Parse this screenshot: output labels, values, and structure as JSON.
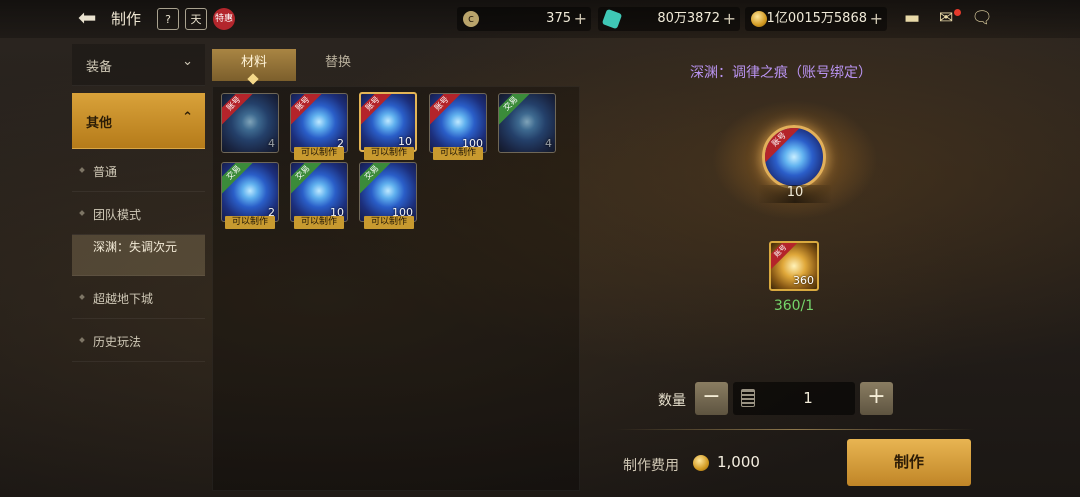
{
  "header": {
    "title": "制作",
    "help_icon": "?",
    "calendar_icon": "天",
    "shop_badge": "特惠",
    "currencies": [
      {
        "icon": "coin-c-icon",
        "value": "375",
        "color": "#c9b27a"
      },
      {
        "icon": "crystal-icon",
        "value": "80万3872",
        "color": "#3fc7b5"
      },
      {
        "icon": "gold-coin-icon",
        "value": "1亿0015万5868",
        "color": "#e5b23a"
      }
    ],
    "plus": "+"
  },
  "sidebar": {
    "sections": [
      {
        "label": "装备",
        "expanded": false
      },
      {
        "label": "其他",
        "expanded": true
      }
    ],
    "items": [
      "普通",
      "团队模式",
      "深渊：失调次元",
      "超越地下城",
      "历史玩法"
    ],
    "selected_index": 2
  },
  "tabs": [
    {
      "label": "材料",
      "active": true
    },
    {
      "label": "替换",
      "active": false
    }
  ],
  "grid": {
    "items": [
      {
        "tag": "账号",
        "tag_color": "red",
        "count": "4",
        "dim": true,
        "craftable": false,
        "selected": false
      },
      {
        "tag": "账号",
        "tag_color": "red",
        "count": "2",
        "dim": false,
        "craftable": true,
        "selected": false
      },
      {
        "tag": "账号",
        "tag_color": "red",
        "count": "10",
        "dim": false,
        "craftable": true,
        "selected": true
      },
      {
        "tag": "账号",
        "tag_color": "red",
        "count": "100",
        "dim": false,
        "craftable": true,
        "selected": false
      },
      {
        "tag": "交易",
        "tag_color": "green",
        "count": "4",
        "dim": true,
        "craftable": false,
        "selected": false
      },
      {
        "tag": "交易",
        "tag_color": "green",
        "count": "2",
        "dim": false,
        "craftable": true,
        "selected": false
      },
      {
        "tag": "交易",
        "tag_color": "green",
        "count": "10",
        "dim": false,
        "craftable": true,
        "selected": false
      },
      {
        "tag": "交易",
        "tag_color": "green",
        "count": "100",
        "dim": false,
        "craftable": true,
        "selected": false
      }
    ],
    "craftable_label": "可以制作"
  },
  "detail": {
    "title": "深渊：调律之痕（账号绑定）",
    "item_tag": "账号",
    "item_count": "10",
    "material_tag": "账号",
    "material_count": "360",
    "material_requirement": "360/1",
    "quantity_label": "数量",
    "quantity_value": "1",
    "minus": "−",
    "plus": "+",
    "fee_label": "制作费用",
    "fee_value": "1,000",
    "make_button": "制作"
  }
}
